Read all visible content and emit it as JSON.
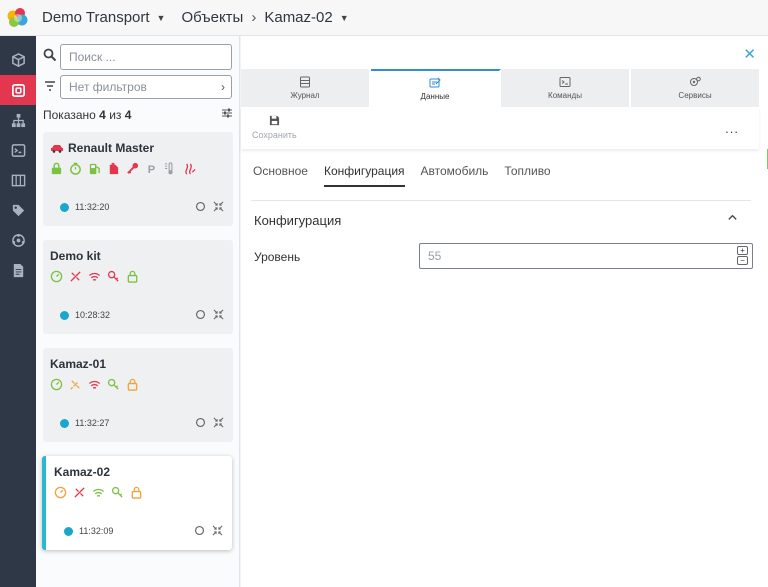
{
  "header": {
    "app_name": "Demo Transport",
    "section": "Объекты",
    "object": "Kamaz-02"
  },
  "nav": {
    "items": [
      "box-icon",
      "objects-icon",
      "hierarchy-icon",
      "terminal-icon",
      "table-icon",
      "tag-icon",
      "network-icon",
      "document-icon"
    ],
    "active_item": "objects-icon"
  },
  "list": {
    "search_placeholder": "Поиск ...",
    "filter_placeholder": "Нет фильтров",
    "count_prefix": "Показано",
    "count_shown": "4",
    "count_sep": "из",
    "count_total": "4",
    "units": [
      {
        "name": "Renault Master",
        "time": "11:32:20",
        "selected": false
      },
      {
        "name": "Demo kit",
        "time": "10:28:32",
        "selected": false
      },
      {
        "name": "Kamaz-01",
        "time": "11:32:27",
        "selected": false
      },
      {
        "name": "Kamaz-02",
        "time": "11:32:09",
        "selected": true
      }
    ]
  },
  "main": {
    "tabs": [
      {
        "label": "Журнал",
        "icon": "journal-icon"
      },
      {
        "label": "Данные",
        "icon": "data-icon",
        "active": true
      },
      {
        "label": "Команды",
        "icon": "commands-icon"
      },
      {
        "label": "Сервисы",
        "icon": "services-icon"
      }
    ],
    "save_label": "Сохранить",
    "more_label": "...",
    "subtabs": [
      "Основное",
      "Конфигурация",
      "Автомобиль",
      "Топливо"
    ],
    "active_subtab": "Конфигурация",
    "section_title": "Конфигурация",
    "field_label": "Уровень",
    "field_value": "55",
    "stepper_up": "+",
    "stepper_down": "−"
  },
  "colors": {
    "nav_bg": "#2f3847",
    "nav_active": "#e2374f",
    "accent": "#29b8cf",
    "status_dot": "#1aa7cf",
    "icon_green": "#7cc242",
    "icon_red": "#e2374f",
    "icon_orange": "#f2a23a"
  }
}
